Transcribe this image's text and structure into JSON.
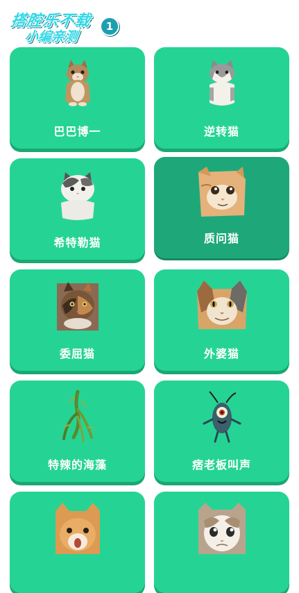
{
  "header": {
    "logo_line1": "搭腔乐不载",
    "logo_line2": "小编亲测",
    "logo_badge": "1"
  },
  "sounds": [
    {
      "label": "巴巴博一",
      "icon": "cat-sitting-icon"
    },
    {
      "label": "逆转猫",
      "icon": "cat-grey-white-icon"
    },
    {
      "label": "希特勒猫",
      "icon": "cat-white-grey-icon"
    },
    {
      "label": "质问猫",
      "icon": "cat-face-questioning-icon"
    },
    {
      "label": "委屈猫",
      "icon": "cat-tortoiseshell-icon"
    },
    {
      "label": "外婆猫",
      "icon": "cat-calico-face-icon"
    },
    {
      "label": "特辣的海藻",
      "icon": "seaweed-icon"
    },
    {
      "label": "痞老板叫声",
      "icon": "plankton-icon"
    },
    {
      "label": "",
      "icon": "cat-orange-face-icon"
    },
    {
      "label": "",
      "icon": "cat-crying-face-icon"
    }
  ],
  "colors": {
    "card": "#25d495",
    "card_shadow": "#1aa873",
    "card_active": "#1ea87a"
  }
}
